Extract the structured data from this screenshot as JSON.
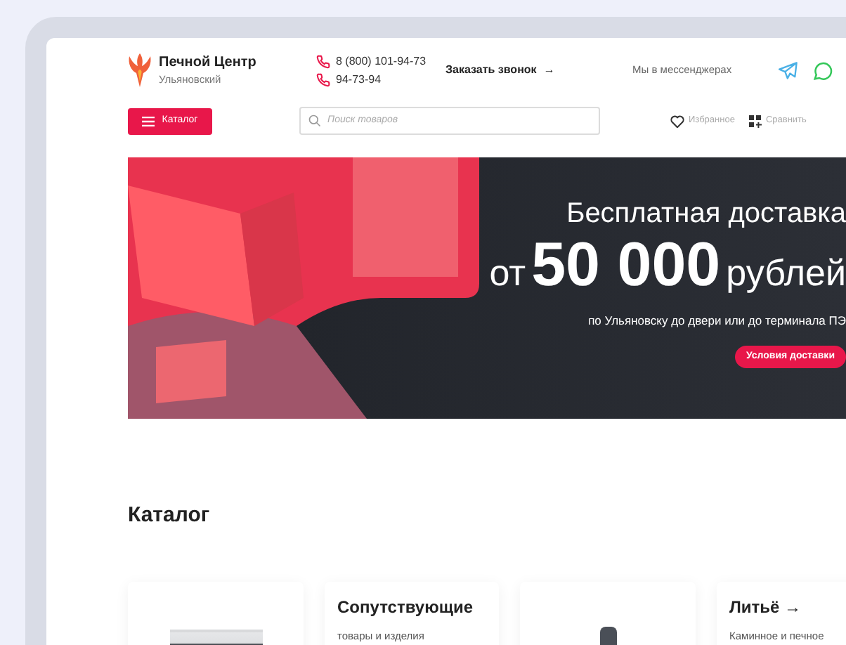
{
  "header": {
    "brand": "Печной Центр",
    "city": "Ульяновский",
    "phones": [
      "8 (800) 101-94-73",
      "94-73-94"
    ],
    "callback": "Заказать звонок",
    "callback_arrow": "→",
    "messengers": "Мы в мессенджерах"
  },
  "nav": {
    "catalog_button": "Каталог",
    "search": {
      "placeholder": "Поиск товаров"
    },
    "favorites": "Избранное",
    "compare": "Сравнить"
  },
  "banner": {
    "title": "Бесплатная доставка",
    "prefix": "от",
    "amount": "50 000",
    "suffix": "рублей",
    "subtitle": "по Ульяновску до двери или до терминала ПЭ",
    "button": "Условия доставки"
  },
  "catalog": {
    "title": "Каталог",
    "cards": [
      {
        "kind": "stove"
      },
      {
        "kind": "text",
        "title": "Сопутствующие",
        "subtitle": "товары и изделия"
      },
      {
        "kind": "pipe"
      },
      {
        "kind": "text",
        "title": "Литьё →",
        "subtitle": "Каминное и печное"
      }
    ]
  }
}
